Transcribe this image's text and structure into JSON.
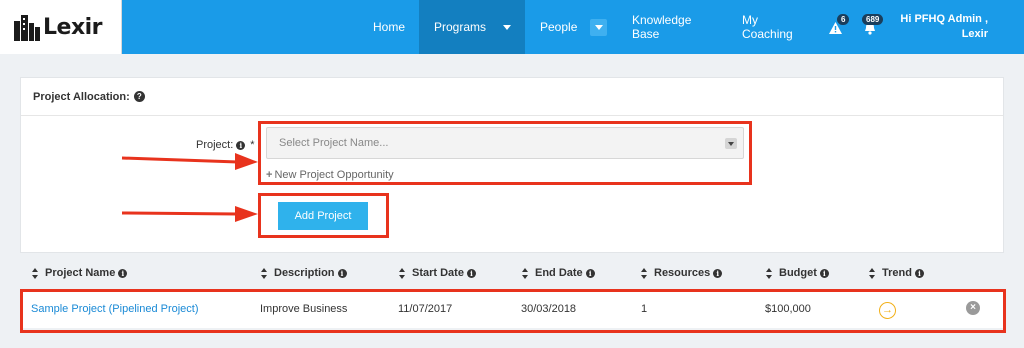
{
  "brand": {
    "name": "Lexir"
  },
  "nav": {
    "items": [
      {
        "label": "Home"
      },
      {
        "label": "Programs"
      },
      {
        "label": "People"
      },
      {
        "label": "Knowledge Base"
      },
      {
        "label": "My Coaching"
      }
    ],
    "alerts_count": "6",
    "notifications_count": "689",
    "user_greeting": "Hi PFHQ Admin ,",
    "user_org": "Lexir"
  },
  "panel": {
    "title": "Project Allocation:",
    "project_label": "Project:",
    "required_mark": "*",
    "project_placeholder": "Select Project Name...",
    "new_opportunity": "New Project Opportunity",
    "add_button": "Add Project"
  },
  "table": {
    "columns": [
      "Project Name",
      "Description",
      "Start Date",
      "End Date",
      "Resources",
      "Budget",
      "Trend"
    ],
    "rows": [
      {
        "project_name": "Sample Project (Pipelined Project)",
        "description": "Improve Business",
        "start_date": "11/07/2017",
        "end_date": "30/03/2018",
        "resources": "1",
        "budget": "$100,000"
      }
    ]
  },
  "colors": {
    "topbar": "#1a9be8",
    "active_nav": "#137fc0",
    "button": "#2fb2ec",
    "annotation_red": "#e8331d",
    "link": "#1a8ad6",
    "trend": "#f2b019"
  },
  "icons": [
    "logo-building-icon",
    "caret-down-icon",
    "warning-icon",
    "bell-icon",
    "help-icon",
    "info-icon",
    "sort-icon",
    "trend-arrow-icon",
    "remove-icon",
    "arrow-annotation-icon"
  ]
}
